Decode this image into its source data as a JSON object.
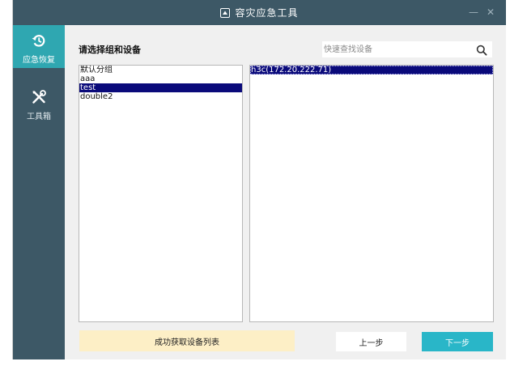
{
  "window": {
    "title": "容灾应急工具",
    "minimize_glyph": "—",
    "close_glyph": "✕"
  },
  "sidebar": {
    "items": [
      {
        "label": "应急恢复",
        "icon": "restore-history-icon",
        "active": true
      },
      {
        "label": "工具箱",
        "icon": "tools-icon",
        "active": false
      }
    ]
  },
  "main": {
    "heading": "请选择组和设备",
    "search_placeholder": "快速查找设备",
    "groups": [
      "默认分组",
      "aaa",
      "test",
      "double2"
    ],
    "selected_group": "test",
    "devices": [
      "h3c(172.20.222.71)"
    ],
    "selected_device": "h3c(172.20.222.71)",
    "status_message": "成功获取设备列表",
    "prev_label": "上一步",
    "next_label": "下一步"
  },
  "colors": {
    "titlebar": "#3d5866",
    "sidebar": "#3d5866",
    "sidebar_active": "#2fa7b1",
    "selection": "#0a0a7a",
    "next_button": "#29b6c8",
    "status_bg": "#fdefc6"
  }
}
